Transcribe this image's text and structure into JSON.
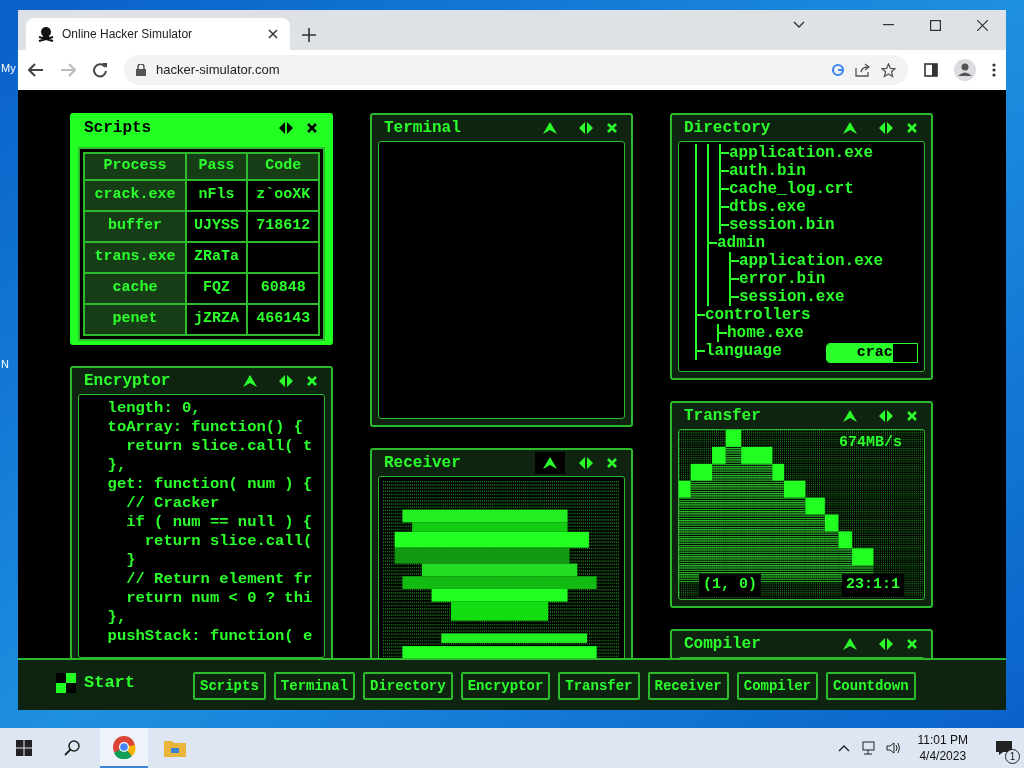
{
  "desktop": {
    "icon_labels": [
      "My",
      "N"
    ]
  },
  "browser": {
    "tab": {
      "title": "Online Hacker Simulator"
    },
    "address": "hacker-simulator.com"
  },
  "columns": [
    [
      {
        "kind": "table",
        "title": "Scripts",
        "active": true,
        "collapsible": false,
        "collapse_hovered": false,
        "columns": [
          "Process",
          "Pass",
          "Code"
        ],
        "rows": [
          [
            "crack.exe",
            "nFls",
            "z`ooXK"
          ],
          [
            "buffer",
            "UJYSS",
            "718612"
          ],
          [
            "trans.exe",
            "ZRaTa",
            ""
          ],
          [
            "cache",
            "FQZ",
            "60848"
          ],
          [
            "penet",
            "jZRZA",
            "466143"
          ]
        ]
      },
      {
        "kind": "code",
        "title": "Encryptor",
        "active": false,
        "collapsible": true,
        "collapse_hovered": false,
        "lines": [
          "  length: 0,",
          "  toArray: function() {",
          "    return slice.call( t",
          "  },",
          "  get: function( num ) {",
          "    // Cracker",
          "    if ( num == null ) {",
          "      return slice.call(",
          "    }",
          "    // Return element fr",
          "    return num < 0 ? thi",
          "  },",
          "  pushStack: function( e"
        ]
      }
    ],
    [
      {
        "kind": "terminal",
        "title": "Terminal",
        "active": false,
        "collapsible": true,
        "collapse_hovered": false
      },
      {
        "kind": "receiver",
        "title": "Receiver",
        "active": false,
        "collapsible": true,
        "collapse_hovered": true
      }
    ],
    [
      {
        "kind": "tree",
        "title": "Directory",
        "active": false,
        "collapsible": true,
        "collapse_hovered": false,
        "tree": [
          {
            "children": [
              {
                "children": [
                  {
                    "children": [
                      {
                        "label": "application.exe"
                      },
                      {
                        "label": "auth.bin"
                      },
                      {
                        "label": "cache_log.crt"
                      },
                      {
                        "label": "dtbs.exe"
                      },
                      {
                        "label": "session.bin"
                      }
                    ]
                  },
                  {
                    "label": "admin",
                    "children": [
                      {
                        "label": "application.exe"
                      },
                      {
                        "label": "error.bin"
                      },
                      {
                        "label": "session.exe"
                      }
                    ]
                  }
                ]
              },
              {
                "label": "controllers",
                "children": [
                  {
                    "label": "home.exe"
                  }
                ]
              },
              {
                "label": "language"
              }
            ]
          }
        ],
        "progress": {
          "label": "crac",
          "level": 0.73
        }
      },
      {
        "kind": "transfer",
        "title": "Transfer",
        "active": false,
        "collapsible": true,
        "collapse_hovered": false,
        "speed": "674MB/s",
        "coords": "(1, 0)",
        "timer": "23:1:1"
      },
      {
        "kind": "empty",
        "title": "Compiler",
        "active": false,
        "collapsible": true,
        "collapse_hovered": false
      }
    ]
  ],
  "dock": {
    "start": "Start",
    "buttons": [
      "Scripts",
      "Terminal",
      "Directory",
      "Encryptor",
      "Transfer",
      "Receiver",
      "Compiler",
      "Countdown"
    ]
  },
  "taskbar": {
    "time": "11:01 PM",
    "date": "4/4/2023",
    "notifications": "1"
  }
}
